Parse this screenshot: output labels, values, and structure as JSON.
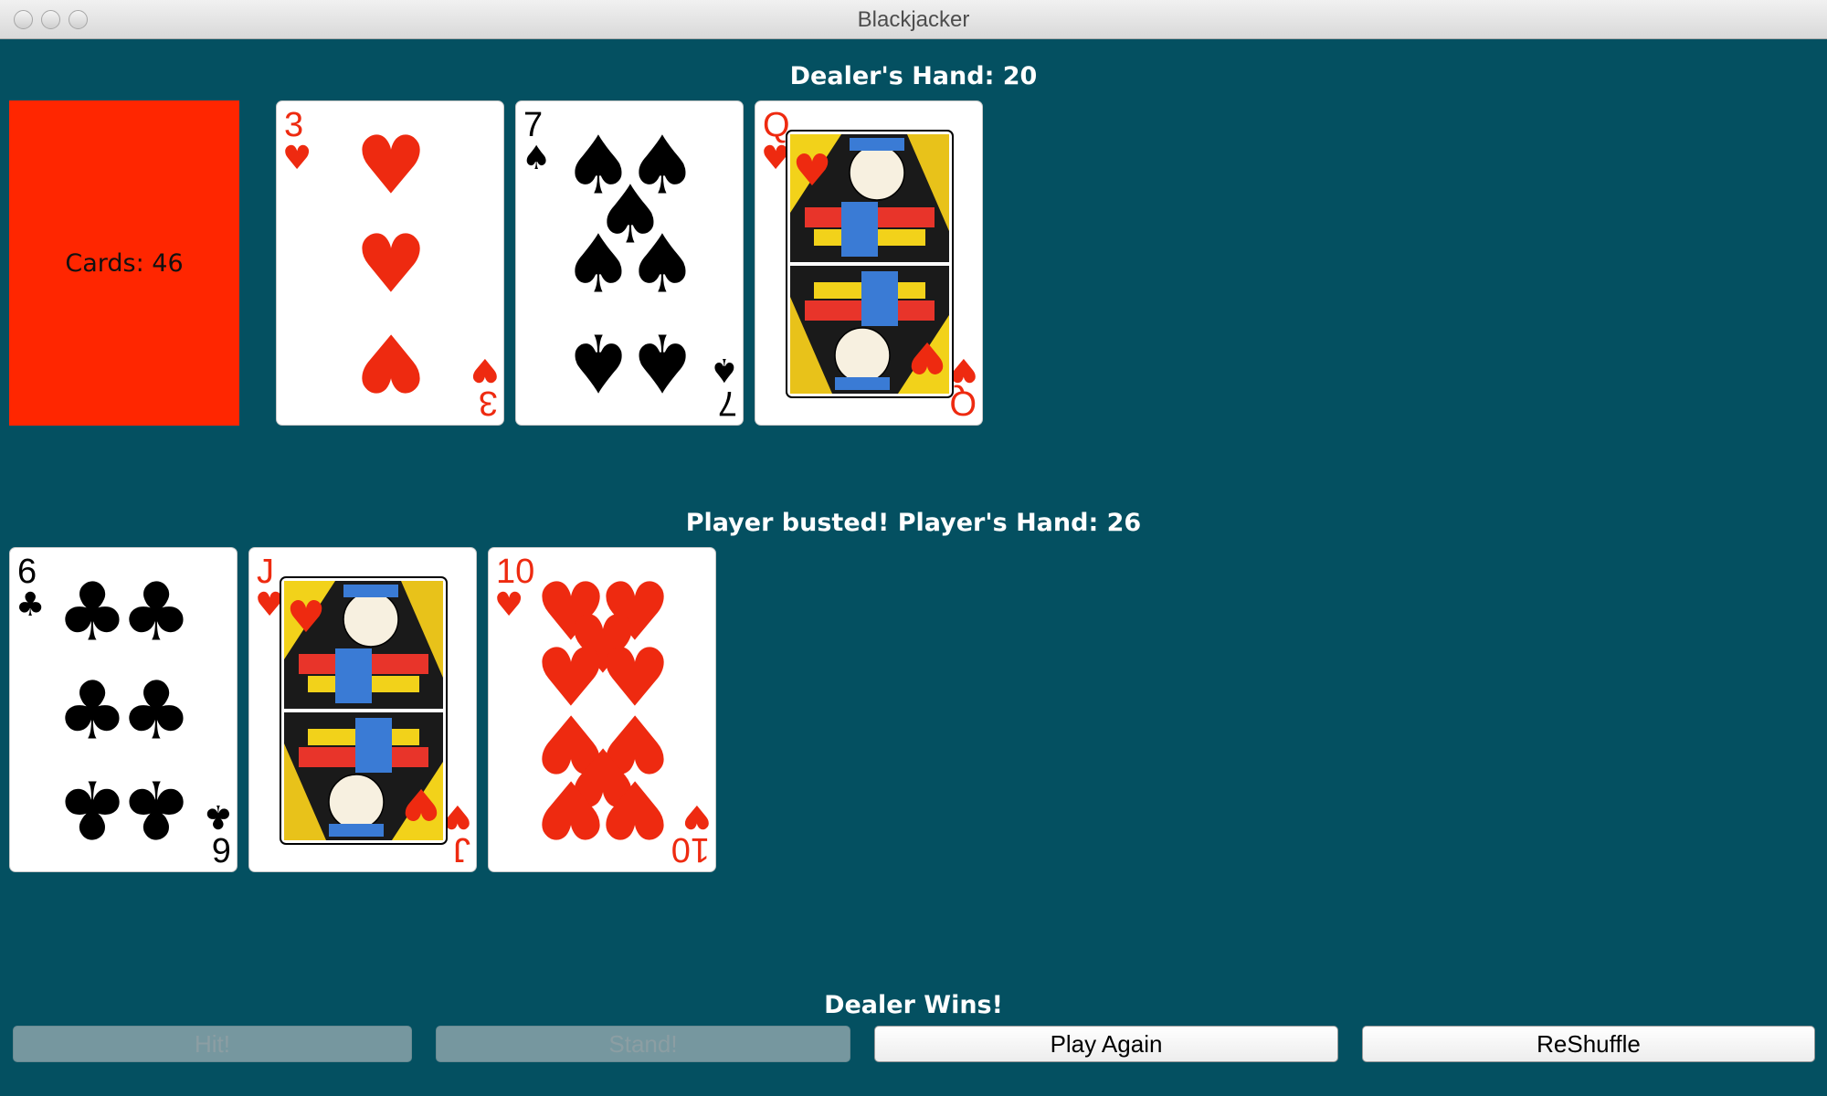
{
  "window": {
    "title": "Blackjacker"
  },
  "deck": {
    "label": "Cards: 46",
    "color": "#ff2600"
  },
  "dealer": {
    "label": "Dealer's Hand: 20",
    "cards": [
      {
        "rank": "3",
        "suit": "hearts"
      },
      {
        "rank": "7",
        "suit": "spades"
      },
      {
        "rank": "Q",
        "suit": "hearts"
      }
    ]
  },
  "player": {
    "label": "Player busted! Player's Hand:  26",
    "cards": [
      {
        "rank": "6",
        "suit": "clubs"
      },
      {
        "rank": "J",
        "suit": "hearts"
      },
      {
        "rank": "10",
        "suit": "hearts"
      }
    ]
  },
  "result": "Dealer Wins!",
  "buttons": {
    "hit": {
      "label": "Hit!",
      "enabled": false
    },
    "stand": {
      "label": "Stand!",
      "enabled": false
    },
    "play_again": {
      "label": "Play Again",
      "enabled": true
    },
    "reshuffle": {
      "label": "ReShuffle",
      "enabled": true
    }
  },
  "colors": {
    "table": "#045061",
    "red_suit": "#ee2a10",
    "black_suit": "#000000"
  }
}
